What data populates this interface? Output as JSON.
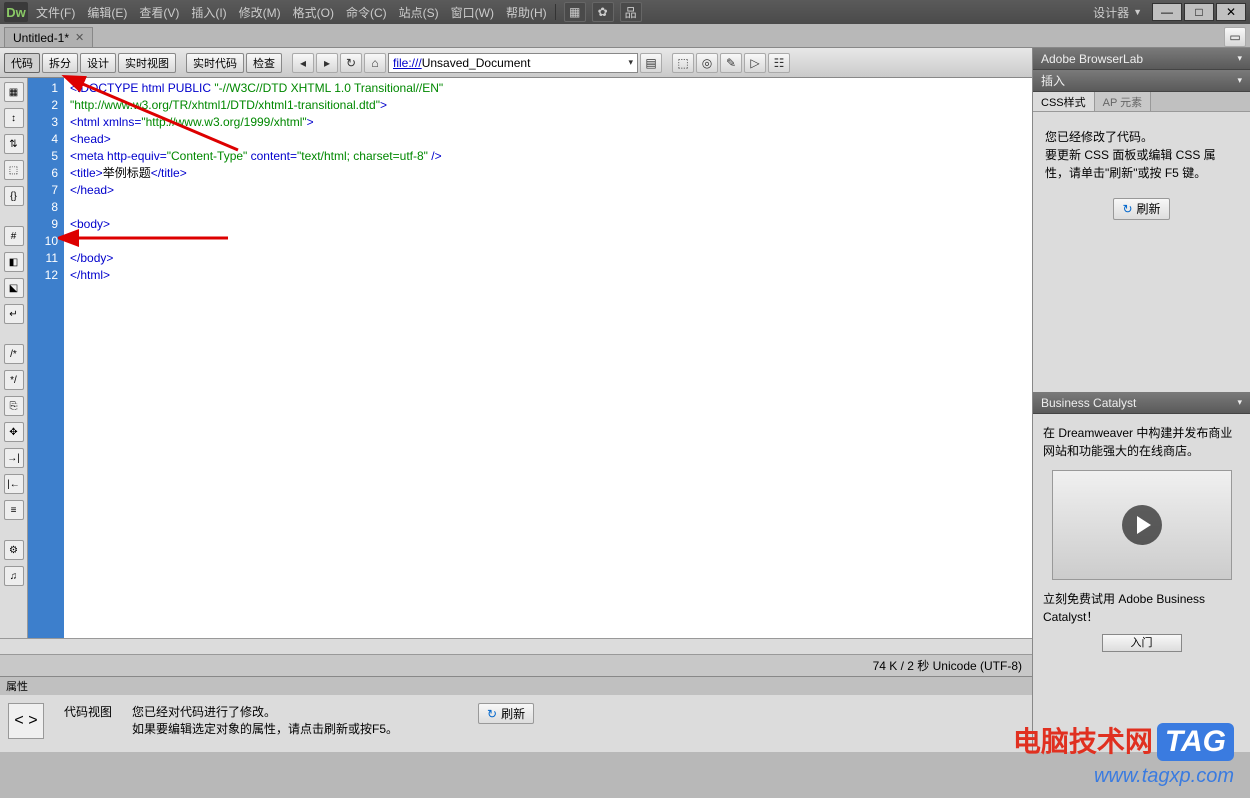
{
  "titlebar": {
    "logo": "Dw",
    "menus": [
      "文件(F)",
      "编辑(E)",
      "查看(V)",
      "插入(I)",
      "修改(M)",
      "格式(O)",
      "命令(C)",
      "站点(S)",
      "窗口(W)",
      "帮助(H)"
    ],
    "designer": "设计器"
  },
  "tab": {
    "title": "Untitled-1*"
  },
  "toolbar": {
    "code": "代码",
    "split": "拆分",
    "design": "设计",
    "live": "实时视图",
    "livecode": "实时代码",
    "inspect": "检查",
    "addr_prefix": "file:///",
    "addr_value": "Unsaved_Document"
  },
  "lines": [
    "1",
    "2",
    "3",
    "4",
    "5",
    "6",
    "7",
    "8",
    "9",
    "10",
    "11",
    "12"
  ],
  "code": {
    "l1a": "<!DOCTYPE html PUBLIC ",
    "l1b": "\"-//W3C//DTD XHTML 1.0 Transitional//EN\"",
    "l2": "\"http://www.w3.org/TR/xhtml1/DTD/xhtml1-transitional.dtd\"",
    "l2b": ">",
    "l3a": "<html xmlns=",
    "l3b": "\"http://www.w3.org/1999/xhtml\"",
    "l3c": ">",
    "l4": "<head>",
    "l5a": "<meta http-equiv=",
    "l5b": "\"Content-Type\"",
    "l5c": " content=",
    "l5d": "\"text/html; charset=utf-8\"",
    "l5e": " />",
    "l6a": "<title>",
    "l6b": "举例标题",
    "l6c": "</title>",
    "l7": "</head>",
    "l8": "",
    "l9": "<body>",
    "l10": "",
    "l11": "</body>",
    "l12": "</html>"
  },
  "status": "74 K / 2 秒 Unicode (UTF-8)",
  "rightpanels": {
    "browserlab": "Adobe BrowserLab",
    "insert": "插入",
    "css": "CSS样式",
    "ap": "AP 元素",
    "cssmsg1": "您已经修改了代码。",
    "cssmsg2": "要更新 CSS 面板或编辑 CSS 属性，请单击\"刷新\"或按 F5 键。",
    "refresh": "刷新",
    "bc": "Business Catalyst",
    "bcmsg": "在 Dreamweaver 中构建并发布商业网站和功能强大的在线商店。",
    "bctrial": "立刻免费试用 Adobe Business Catalyst！",
    "bcstart": "入门"
  },
  "prop": {
    "title": "属性",
    "codeview": "代码视图",
    "msg1": "您已经对代码进行了修改。",
    "msg2": "如果要编辑选定对象的属性，请点击刷新或按F5。",
    "refresh": "刷新"
  },
  "watermark": {
    "text": "电脑技术网",
    "tag": "TAG",
    "url": "www.tagxp.com"
  }
}
